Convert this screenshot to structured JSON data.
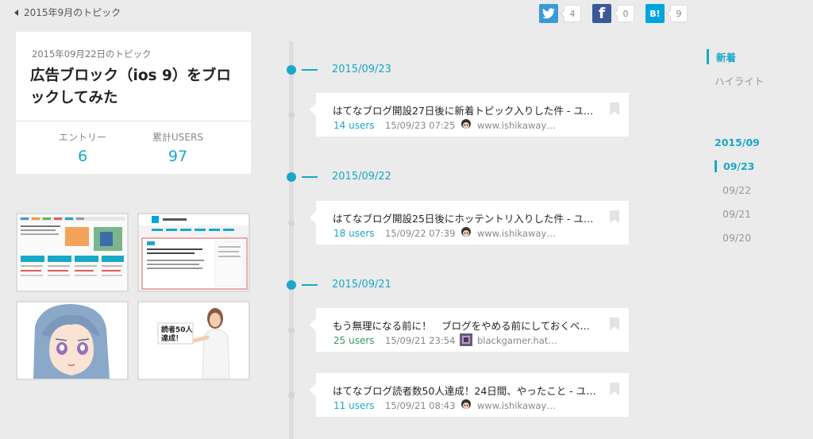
{
  "header": {
    "back_label": "2015年9月のトピック",
    "shares": [
      {
        "service": "twitter",
        "icon": "twitter-icon",
        "glyph": "t",
        "count": "4",
        "color": "#3a9ad9"
      },
      {
        "service": "facebook",
        "icon": "facebook-icon",
        "glyph": "f",
        "count": "0",
        "color": "#3b5998"
      },
      {
        "service": "hatena",
        "icon": "hatena-bookmark-icon",
        "glyph": "B!",
        "count": "9",
        "color": "#00a4de"
      }
    ]
  },
  "topic": {
    "date": "2015年09月22日のトピック",
    "title": "広告ブロック（ios 9）をブロックしてみた",
    "stats": {
      "entries_label": "エントリー",
      "entries_value": "6",
      "users_label": "累計USERS",
      "users_value": "97"
    }
  },
  "thumbnails": [
    {
      "name": "thumb-blog-screenshot",
      "kind": "blog-page"
    },
    {
      "name": "thumb-hatena-screenshot",
      "kind": "hatena-page",
      "caption": "はてなブックマーク"
    },
    {
      "name": "thumb-anime-character",
      "kind": "anime-girl"
    },
    {
      "name": "thumb-50-readers",
      "kind": "woman-sign",
      "sign_text": "読者50人達成！"
    }
  ],
  "timeline": [
    {
      "date": "2015/09/23",
      "entries": [
        {
          "title": "はてなブログ開設27日後に新着トピック入りした件 - ユ…",
          "users": "14 users",
          "users_color": "blue",
          "time": "15/09/23 07:25",
          "domain": "www.ishikaway…"
        }
      ]
    },
    {
      "date": "2015/09/22",
      "entries": [
        {
          "title": "はてなブログ開設25日後にホッテントリ入りした件 - ユ…",
          "users": "18 users",
          "users_color": "blue",
          "time": "15/09/22 07:39",
          "domain": "www.ishikaway…"
        }
      ]
    },
    {
      "date": "2015/09/21",
      "entries": [
        {
          "title": "もう無理になる前に！　ブログをやめる前にしておくべ…",
          "users": "25 users",
          "users_color": "green",
          "time": "15/09/21 23:54",
          "domain": "blackgamer.hat…"
        },
        {
          "title": "はてなブログ読者数50人達成！24日間、やったこと - ユ…",
          "users": "11 users",
          "users_color": "blue",
          "time": "15/09/21 08:43",
          "domain": "www.ishikaway…"
        }
      ]
    }
  ],
  "side_nav": {
    "tabs": [
      "新着",
      "ハイライト"
    ],
    "active_tab": "新着",
    "month": "2015/09",
    "days": [
      "09/23",
      "09/22",
      "09/21",
      "09/20"
    ],
    "active_day": "09/23"
  }
}
